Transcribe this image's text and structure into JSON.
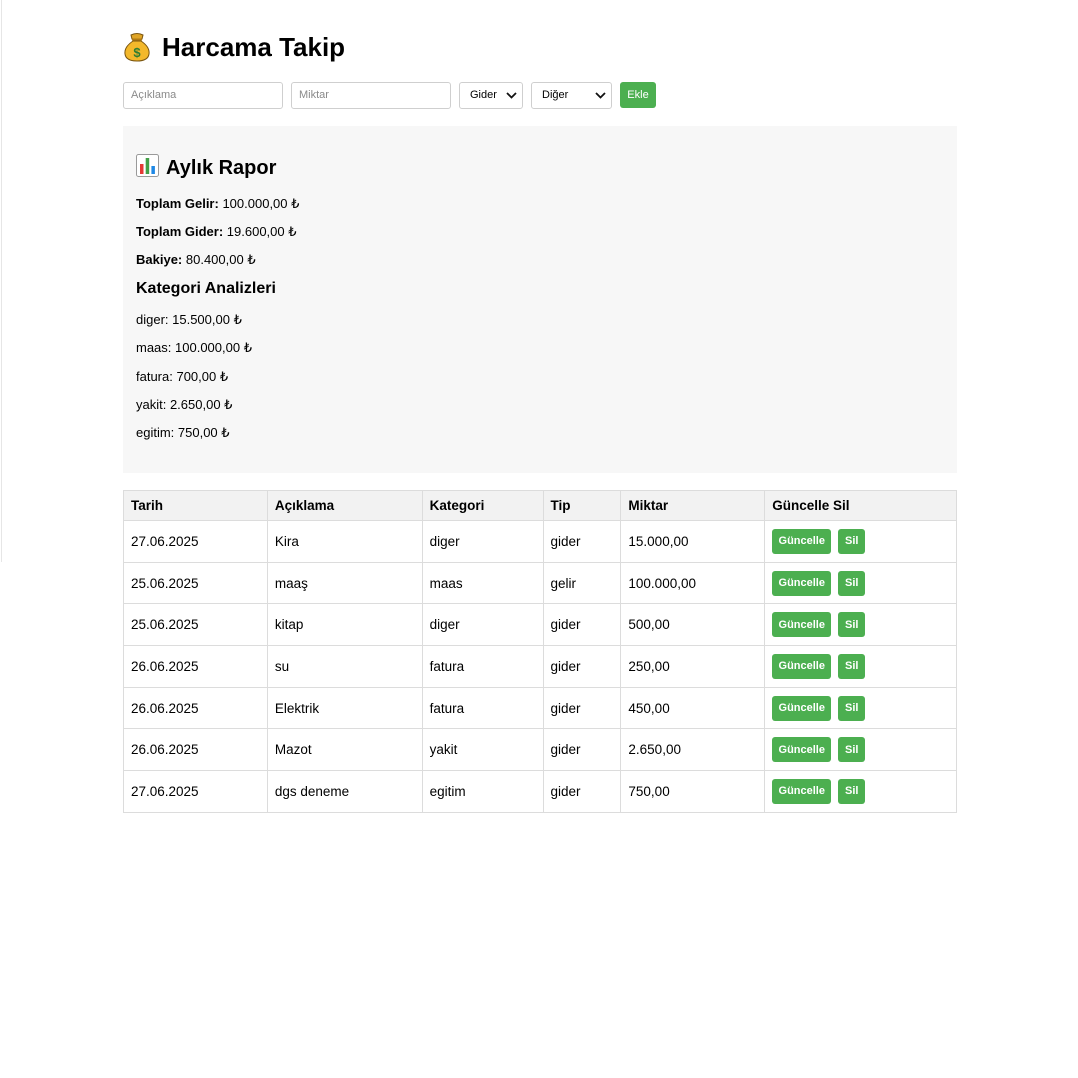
{
  "app": {
    "title": "Harcama Takip",
    "title_icon": "money-bag-icon"
  },
  "form": {
    "description_placeholder": "Açıklama",
    "amount_placeholder": "Miktar",
    "type_selected": "Gider",
    "category_selected": "Diğer",
    "add_label": "Ekle"
  },
  "report": {
    "title": "Aylık Rapor",
    "title_icon": "bar-chart-icon",
    "total_income_label": "Toplam Gelir:",
    "total_income_value": "100.000,00 ₺",
    "total_expense_label": "Toplam Gider:",
    "total_expense_value": "19.600,00 ₺",
    "balance_label": "Bakiye:",
    "balance_value": "80.400,00 ₺",
    "category_title": "Kategori Analizleri",
    "categories": [
      "diger: 15.500,00 ₺",
      "maas: 100.000,00 ₺",
      "fatura: 700,00 ₺",
      "yakit: 2.650,00 ₺",
      "egitim: 750,00 ₺"
    ]
  },
  "table": {
    "headers": [
      "Tarih",
      "Açıklama",
      "Kategori",
      "Tip",
      "Miktar",
      "Güncelle Sil"
    ],
    "update_label": "Güncelle",
    "delete_label": "Sil",
    "rows": [
      [
        "27.06.2025",
        "Kira",
        "diger",
        "gider",
        "15.000,00"
      ],
      [
        "25.06.2025",
        "maaş",
        "maas",
        "gelir",
        "100.000,00"
      ],
      [
        "25.06.2025",
        "kitap",
        "diger",
        "gider",
        "500,00"
      ],
      [
        "26.06.2025",
        "su",
        "fatura",
        "gider",
        "250,00"
      ],
      [
        "26.06.2025",
        "Elektrik",
        "fatura",
        "gider",
        "450,00"
      ],
      [
        "26.06.2025",
        "Mazot",
        "yakit",
        "gider",
        "2.650,00"
      ],
      [
        "27.06.2025",
        "dgs deneme",
        "egitim",
        "gider",
        "750,00"
      ]
    ]
  },
  "colors": {
    "accent": "#4caf50",
    "panel": "#f7f7f7",
    "header_bg": "#f2f2f2"
  }
}
